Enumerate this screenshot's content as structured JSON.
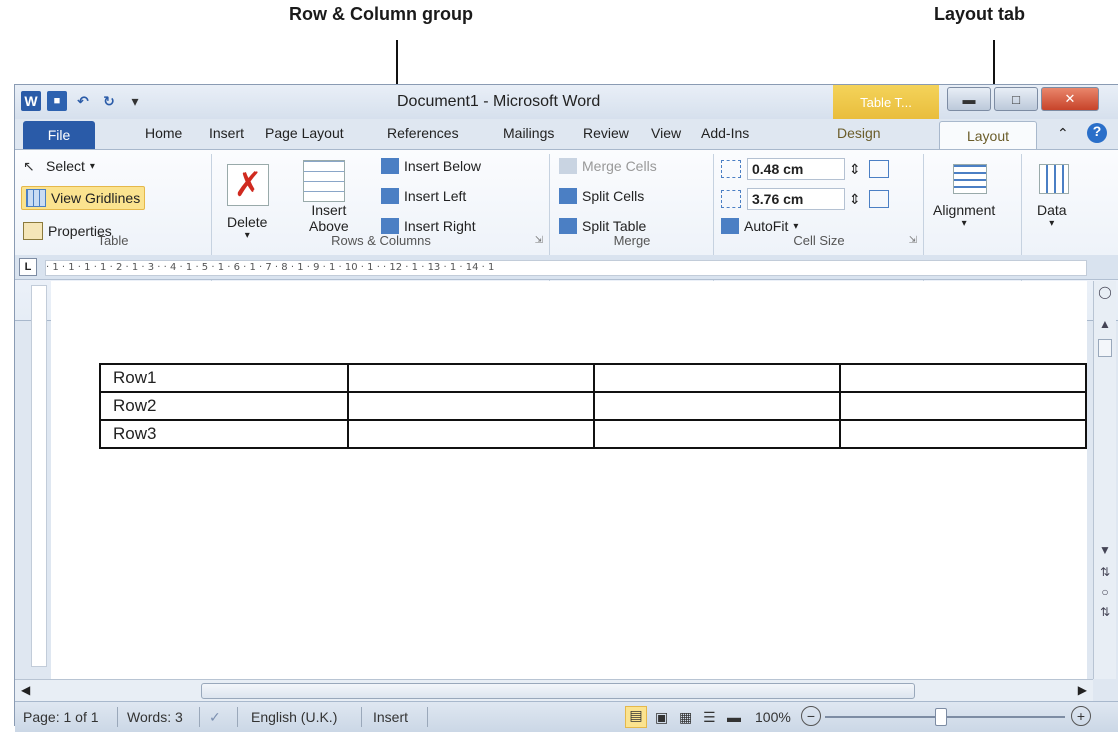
{
  "callouts": {
    "row_column_group": "Row & Column group",
    "layout_tab": "Layout tab"
  },
  "window": {
    "title": "Document1  -  Microsoft Word",
    "context_tab": "Table T...",
    "quick_access": [
      "word-logo-icon",
      "save-icon",
      "undo-icon",
      "redo-icon"
    ]
  },
  "tabs": [
    "File",
    "Home",
    "Insert",
    "Page Layout",
    "References",
    "Mailings",
    "Review",
    "View",
    "Add-Ins",
    "Design",
    "Layout"
  ],
  "ribbon": {
    "table": {
      "label": "Table",
      "select": "Select",
      "view_gridlines": "View Gridlines",
      "properties": "Properties"
    },
    "rows_columns": {
      "label": "Rows & Columns",
      "delete": "Delete",
      "insert_above_1": "Insert",
      "insert_above_2": "Above",
      "insert_below": "Insert Below",
      "insert_left": "Insert Left",
      "insert_right": "Insert Right"
    },
    "merge": {
      "label": "Merge",
      "merge_cells": "Merge Cells",
      "split_cells": "Split Cells",
      "split_table": "Split Table"
    },
    "cell_size": {
      "label": "Cell Size",
      "height": "0.48 cm",
      "width": "3.76 cm",
      "autofit": "AutoFit"
    },
    "alignment": "Alignment",
    "data": "Data"
  },
  "ruler": "  · 1 · 1 · 1 · 1 · 2 · 1 · 3 ·  · 4 · 1 · 5 · 1 · 6 · 1 · 7  · 8 · 1 · 9 · 1 · 10 · 1 ·      · 12 · 1 · 13 · 1 · 14 · 1",
  "table_rows": [
    [
      "Row1",
      "",
      "",
      ""
    ],
    [
      "Row2",
      "",
      "",
      ""
    ],
    [
      "Row3",
      "",
      "",
      ""
    ]
  ],
  "status": {
    "page": "Page: 1 of 1",
    "words": "Words: 3",
    "language": "English (U.K.)",
    "mode": "Insert",
    "zoom": "100%"
  },
  "colors": {
    "file_tab": "#2a5ba8",
    "context_tab": "#e9bd3c",
    "highlight": "#fbe38f"
  }
}
